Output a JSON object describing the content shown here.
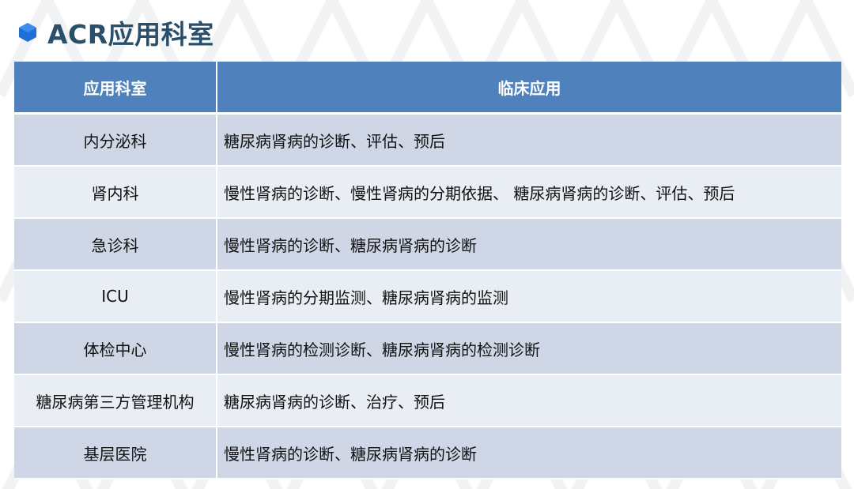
{
  "page": {
    "title": "ACR应用科室",
    "accent_color": "#1f6fd6",
    "header_color": "#4f81bd",
    "icon": "hexagon-bullet-icon"
  },
  "table": {
    "headers": [
      "应用科室",
      "临床应用"
    ],
    "rows": [
      {
        "dept": "内分泌科",
        "app": "糖尿病肾病的诊断、评估、预后"
      },
      {
        "dept": "肾内科",
        "app": "慢性肾病的诊断、慢性肾病的分期依据、 糖尿病肾病的诊断、评估、预后"
      },
      {
        "dept": "急诊科",
        "app": "慢性肾病的诊断、糖尿病肾病的诊断"
      },
      {
        "dept": "ICU",
        "app": "慢性肾病的分期监测、糖尿病肾病的监测"
      },
      {
        "dept": "体检中心",
        "app": "慢性肾病的检测诊断、糖尿病肾病的检测诊断"
      },
      {
        "dept": "糖尿病第三方管理机构",
        "app": "糖尿病肾病的诊断、治疗、预后"
      },
      {
        "dept": "基层医院",
        "app": "慢性肾病的诊断、糖尿病肾病的诊断"
      }
    ]
  }
}
